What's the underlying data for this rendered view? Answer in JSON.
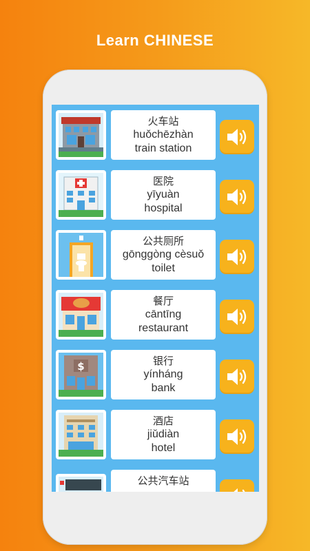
{
  "header": {
    "title": "Learn CHINESE"
  },
  "colors": {
    "accent": "#f7b21c",
    "list_bg": "#5ab8ef",
    "card": "#ffffff"
  },
  "vocab": [
    {
      "hanzi": "火车站",
      "pinyin": "huǒchēzhàn",
      "english": "train station",
      "icon": "train-station-icon"
    },
    {
      "hanzi": "医院",
      "pinyin": "yīyuàn",
      "english": "hospital",
      "icon": "hospital-icon"
    },
    {
      "hanzi": "公共厕所",
      "pinyin": "gōnggòng cèsuǒ",
      "english": "toilet",
      "icon": "toilet-icon"
    },
    {
      "hanzi": "餐厅",
      "pinyin": "cāntīng",
      "english": "restaurant",
      "icon": "restaurant-icon"
    },
    {
      "hanzi": "银行",
      "pinyin": "yínháng",
      "english": "bank",
      "icon": "bank-icon"
    },
    {
      "hanzi": "酒店",
      "pinyin": "jiǔdiàn",
      "english": "hotel",
      "icon": "hotel-icon"
    },
    {
      "hanzi": "公共汽车站",
      "pinyin": "",
      "english": "",
      "icon": "bus-stop-icon"
    }
  ]
}
